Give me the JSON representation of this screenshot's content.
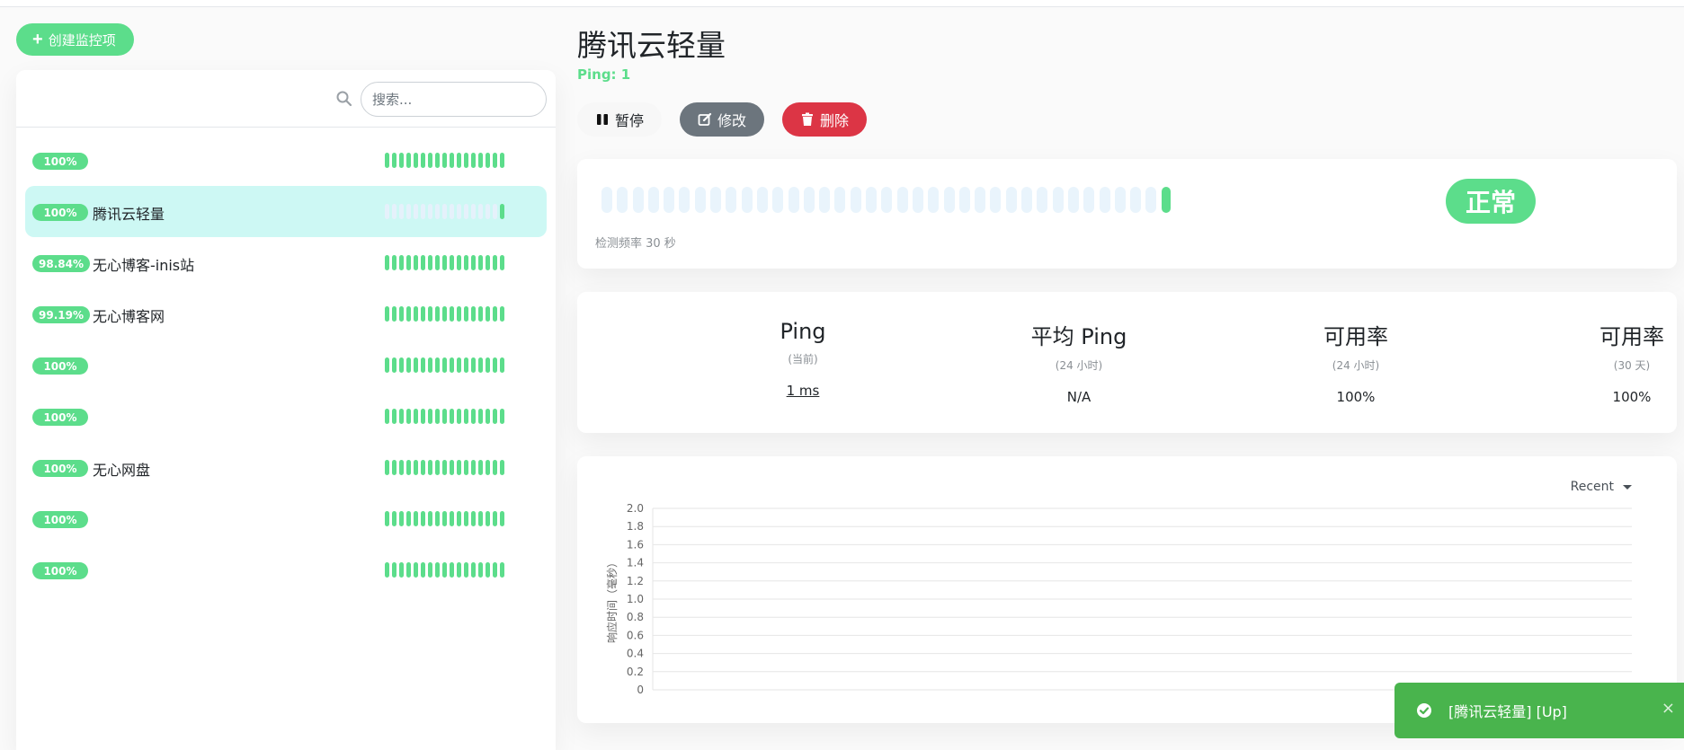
{
  "left": {
    "create_label": "创建监控项",
    "search_placeholder": "搜索...",
    "monitors": [
      {
        "uptime": "100%",
        "name": "",
        "active": false
      },
      {
        "uptime": "100%",
        "name": "腾讯云轻量",
        "active": true
      },
      {
        "uptime": "98.84%",
        "name": "无心博客-inis站",
        "active": false
      },
      {
        "uptime": "99.19%",
        "name": "无心博客网",
        "active": false
      },
      {
        "uptime": "100%",
        "name": "",
        "active": false
      },
      {
        "uptime": "100%",
        "name": "",
        "active": false
      },
      {
        "uptime": "100%",
        "name": "无心网盘",
        "active": false
      },
      {
        "uptime": "100%",
        "name": "",
        "active": false
      },
      {
        "uptime": "100%",
        "name": "",
        "active": false
      }
    ]
  },
  "detail": {
    "title": "腾讯云轻量",
    "ping_target": "Ping: 1",
    "pause_label": "暂停",
    "edit_label": "修改",
    "delete_label": "删除",
    "status": "正常",
    "interval": "检测频率 30 秒",
    "stats": [
      {
        "title": "Ping",
        "sub": "(当前)",
        "value": "1 ms"
      },
      {
        "title": "平均 Ping",
        "sub": "(24 小时)",
        "value": "N/A"
      },
      {
        "title": "可用率",
        "sub": "(24 小时)",
        "value": "100%"
      },
      {
        "title": "可用率",
        "sub": "(30 天)",
        "value": "100%"
      }
    ],
    "range_label": "Recent"
  },
  "chart_data": {
    "type": "line",
    "ylabel": "响应时间（毫秒）",
    "ylim": [
      0,
      2.0
    ],
    "yticks": [
      "2.0",
      "1.8",
      "1.6",
      "1.4",
      "1.2",
      "1.0",
      "0.8",
      "0.6",
      "0.4",
      "0.2",
      "0"
    ],
    "series": []
  },
  "toast": {
    "message": "[腾讯云轻量] [Up]",
    "close": "×"
  },
  "colors": {
    "up": "#5cdd8b",
    "pending_empty": "#e9f4fc",
    "danger": "#dc3545",
    "secondary": "#6c757d",
    "toast": "#49b44d"
  }
}
